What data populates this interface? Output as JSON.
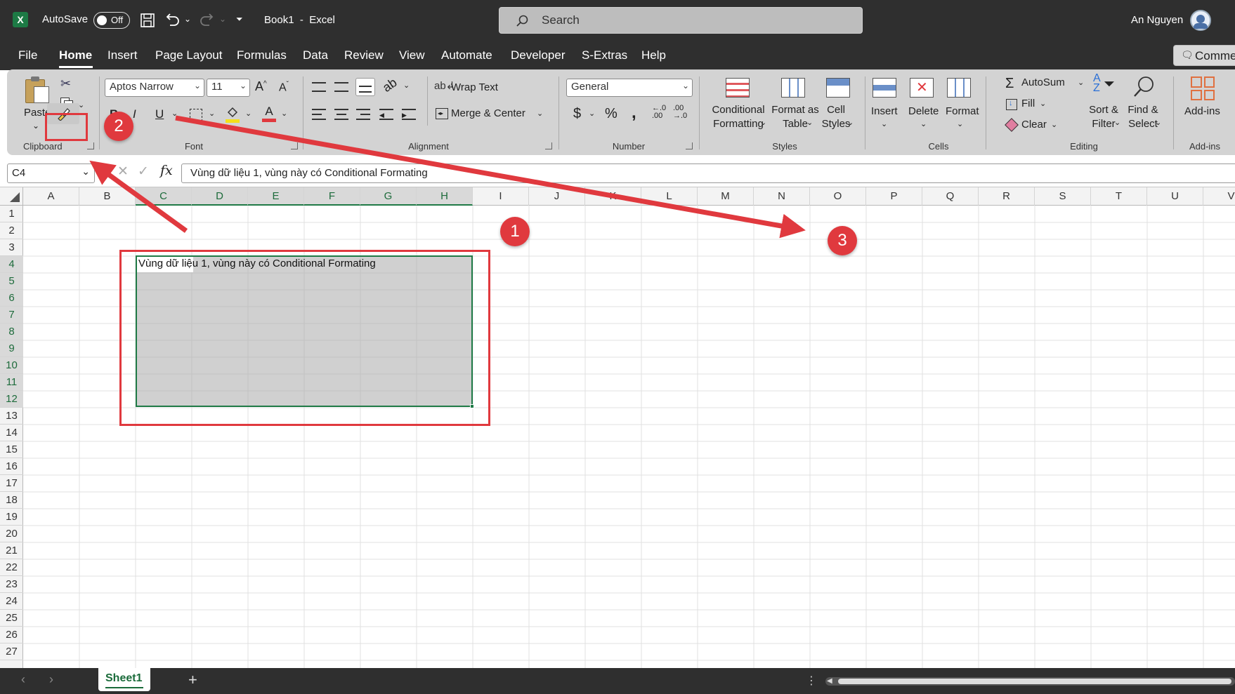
{
  "titlebar": {
    "autosave_label": "AutoSave",
    "autosave_state": "Off",
    "doc_title": "Book1  -  Excel",
    "search_placeholder": "Search",
    "user_name": "An Nguyen"
  },
  "tabs": [
    {
      "label": "File"
    },
    {
      "label": "Home"
    },
    {
      "label": "Insert"
    },
    {
      "label": "Page Layout"
    },
    {
      "label": "Formulas"
    },
    {
      "label": "Data"
    },
    {
      "label": "Review"
    },
    {
      "label": "View"
    },
    {
      "label": "Automate"
    },
    {
      "label": "Developer"
    },
    {
      "label": "S-Extras"
    },
    {
      "label": "Help"
    }
  ],
  "comments_button": "Comme",
  "ribbon": {
    "clipboard": {
      "paste": "Paste",
      "label": "Clipboard"
    },
    "font": {
      "name": "Aptos Narrow",
      "size": "11",
      "label": "Font"
    },
    "alignment": {
      "wrap": "Wrap Text",
      "merge": "Merge & Center",
      "label": "Alignment"
    },
    "number": {
      "format": "General",
      "label": "Number"
    },
    "styles": {
      "conditional": "Conditional\nFormatting",
      "format_table": "Format as\nTable",
      "cell_styles": "Cell\nStyles",
      "label": "Styles"
    },
    "cells": {
      "insert": "Insert",
      "delete": "Delete",
      "format": "Format",
      "label": "Cells"
    },
    "editing": {
      "autosum": "AutoSum",
      "fill": "Fill",
      "clear": "Clear",
      "sort": "Sort &\nFilter",
      "find": "Find &\nSelect",
      "label": "Editing"
    },
    "addins": {
      "addins": "Add-ins",
      "label": "Add-ins"
    }
  },
  "formula_bar": {
    "name_box": "C4",
    "formula": "Vùng dữ liệu 1, vùng này có Conditional Formating"
  },
  "columns": [
    "A",
    "B",
    "C",
    "D",
    "E",
    "F",
    "G",
    "H",
    "I",
    "J",
    "K",
    "L",
    "M",
    "N",
    "O",
    "P",
    "Q",
    "R",
    "S",
    "T",
    "U",
    "V"
  ],
  "rows": [
    "1",
    "2",
    "3",
    "4",
    "5",
    "6",
    "7",
    "8",
    "9",
    "10",
    "11",
    "12",
    "13",
    "14",
    "15",
    "16",
    "17",
    "18",
    "19",
    "20",
    "21",
    "22",
    "23",
    "24",
    "25",
    "26",
    "27"
  ],
  "cell_c4": "Vùng dữ liệu 1, vùng này có Conditional Formating",
  "sheet_tab": "Sheet1",
  "annotations": [
    "1",
    "2",
    "3"
  ],
  "colors": {
    "accent": "#1f7a46",
    "annotation": "#e0393e",
    "selection": "#c8c8c8"
  }
}
